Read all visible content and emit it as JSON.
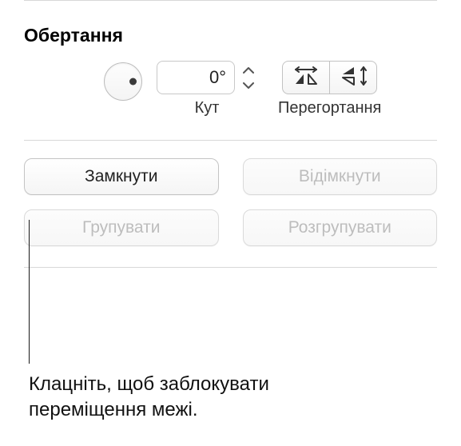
{
  "rotation": {
    "title": "Обертання",
    "angle_value": "0°",
    "angle_label": "Кут",
    "flip_label": "Перегортання"
  },
  "buttons": {
    "lock": "Замкнути",
    "unlock": "Відімкнути",
    "group": "Групувати",
    "ungroup": "Розгрупувати"
  },
  "callout": {
    "text": "Клацніть, щоб заблокувати переміщення межі."
  }
}
